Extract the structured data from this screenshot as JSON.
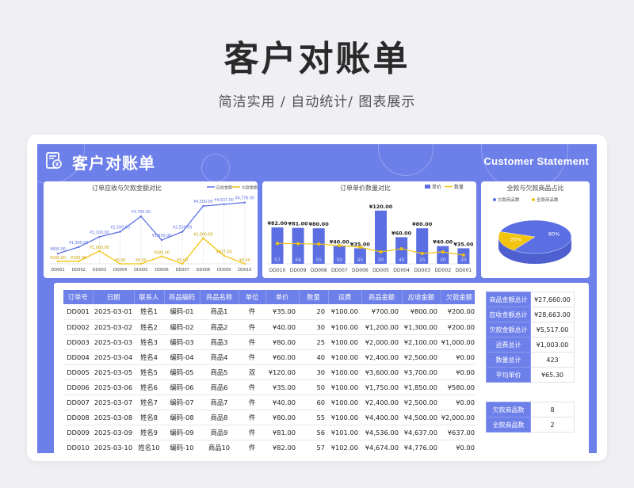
{
  "hero": {
    "title": "客户对账单",
    "subtitle": "简洁实用 / 自动统计/ 图表展示"
  },
  "header": {
    "title": "客户对账单",
    "title_en": "Customer  Statement"
  },
  "colors": {
    "primary": "#6d7fe9",
    "line_blue": "#5b6fe3",
    "line_yellow": "#f2c40f",
    "pie_yellow": "#f2c40f"
  },
  "chart1": {
    "title": "订单应收与欠款金额对比",
    "legend": [
      "应收金额",
      "欠款金额"
    ],
    "orders": [
      "DD001",
      "DD002",
      "DD003",
      "DD004",
      "DD005",
      "DD006",
      "DD007",
      "DD008",
      "DD009",
      "DD010"
    ],
    "receivable": [
      800,
      1300,
      2100,
      2500,
      3700,
      1850,
      2500,
      4500,
      4637,
      4776
    ],
    "debt": [
      200,
      200,
      1000,
      0,
      0,
      580,
      0,
      2000,
      637,
      0
    ],
    "receivable_labels": [
      "¥800.00",
      "¥1,300.00",
      "¥2,100.00",
      "¥2,500.00",
      "¥3,700.00",
      "¥1,850.00",
      "¥2,500.00",
      "¥4,500.00",
      "¥4,637.00",
      "¥4,776.00"
    ],
    "debt_labels": [
      "¥200.00",
      "¥200.00",
      "¥1,000.00",
      "¥0.00",
      "¥0.00",
      "¥580.00",
      "¥0.00",
      "¥2,000.00",
      "¥637.00",
      "¥0.00"
    ]
  },
  "chart2": {
    "title": "订单单价数量对比",
    "legend": [
      "单价",
      "数量"
    ],
    "orders": [
      "DD010",
      "DD009",
      "DD008",
      "DD007",
      "DD006",
      "DD005",
      "DD004",
      "DD003",
      "DD002",
      "DD001"
    ],
    "price": [
      82,
      81,
      80,
      40,
      35,
      120,
      60,
      80,
      40,
      35
    ],
    "price_labels": [
      "¥82.00",
      "¥81.00",
      "¥80.00",
      "¥40.00",
      "¥35.00",
      "¥120.00",
      "¥60.00",
      "¥80.00",
      "¥40.00",
      "¥35.00"
    ],
    "qty": [
      57,
      56,
      55,
      50,
      45,
      30,
      40,
      25,
      30,
      20
    ]
  },
  "chart3": {
    "title": "全款与欠款商品占比",
    "legend": [
      "欠款商品数",
      "全款商品数"
    ],
    "slices": [
      {
        "name": "欠款商品数",
        "value": 80,
        "label": "80%"
      },
      {
        "name": "全款商品数",
        "value": 20,
        "label": "20%"
      }
    ]
  },
  "table": {
    "headers": [
      "订单号",
      "日期",
      "联系人",
      "商品编码",
      "商品名称",
      "单位",
      "单价",
      "数量",
      "运费",
      "商品金额",
      "应收金额",
      "欠款金额"
    ],
    "rows": [
      [
        "DD001",
        "2025-03-01",
        "姓名1",
        "编码-01",
        "商品1",
        "件",
        "¥35.00",
        "20",
        "¥100.00",
        "¥700.00",
        "¥800.00",
        "¥200.00"
      ],
      [
        "DD002",
        "2025-03-02",
        "姓名2",
        "编码-02",
        "商品2",
        "件",
        "¥40.00",
        "30",
        "¥100.00",
        "¥1,200.00",
        "¥1,300.00",
        "¥200.00"
      ],
      [
        "DD003",
        "2025-03-03",
        "姓名3",
        "编码-03",
        "商品3",
        "件",
        "¥80.00",
        "25",
        "¥100.00",
        "¥2,000.00",
        "¥2,100.00",
        "¥1,000.00"
      ],
      [
        "DD004",
        "2025-03-04",
        "姓名4",
        "编码-04",
        "商品4",
        "件",
        "¥60.00",
        "40",
        "¥100.00",
        "¥2,400.00",
        "¥2,500.00",
        "¥0.00"
      ],
      [
        "DD005",
        "2025-03-05",
        "姓名5",
        "编码-05",
        "商品5",
        "双",
        "¥120.00",
        "30",
        "¥100.00",
        "¥3,600.00",
        "¥3,700.00",
        "¥0.00"
      ],
      [
        "DD006",
        "2025-03-06",
        "姓名6",
        "编码-06",
        "商品6",
        "件",
        "¥35.00",
        "50",
        "¥100.00",
        "¥1,750.00",
        "¥1,850.00",
        "¥580.00"
      ],
      [
        "DD007",
        "2025-03-07",
        "姓名7",
        "编码-07",
        "商品7",
        "件",
        "¥40.00",
        "60",
        "¥100.00",
        "¥2,400.00",
        "¥2,500.00",
        "¥0.00"
      ],
      [
        "DD008",
        "2025-03-08",
        "姓名8",
        "编码-08",
        "商品8",
        "件",
        "¥80.00",
        "55",
        "¥100.00",
        "¥4,400.00",
        "¥4,500.00",
        "¥2,000.00"
      ],
      [
        "DD009",
        "2025-03-09",
        "姓名9",
        "编码-09",
        "商品9",
        "件",
        "¥81.00",
        "56",
        "¥101.00",
        "¥4,536.00",
        "¥4,637.00",
        "¥637.00"
      ],
      [
        "DD010",
        "2025-03-10",
        "姓名10",
        "编码-10",
        "商品10",
        "件",
        "¥82.00",
        "57",
        "¥102.00",
        "¥4,674.00",
        "¥4,776.00",
        "¥0.00"
      ]
    ]
  },
  "summary": [
    {
      "label": "商品金额总计",
      "value": "¥27,660.00"
    },
    {
      "label": "应收金额总计",
      "value": "¥28,663.00"
    },
    {
      "label": "欠款金额总计",
      "value": "¥5,517.00"
    },
    {
      "label": "运费总计",
      "value": "¥1,003.00"
    },
    {
      "label": "数量总计",
      "value": "423"
    },
    {
      "label": "平均单价",
      "value": "¥65.30"
    }
  ],
  "summary2": [
    {
      "label": "欠款商品数",
      "value": "8"
    },
    {
      "label": "全款商品数",
      "value": "2"
    }
  ]
}
